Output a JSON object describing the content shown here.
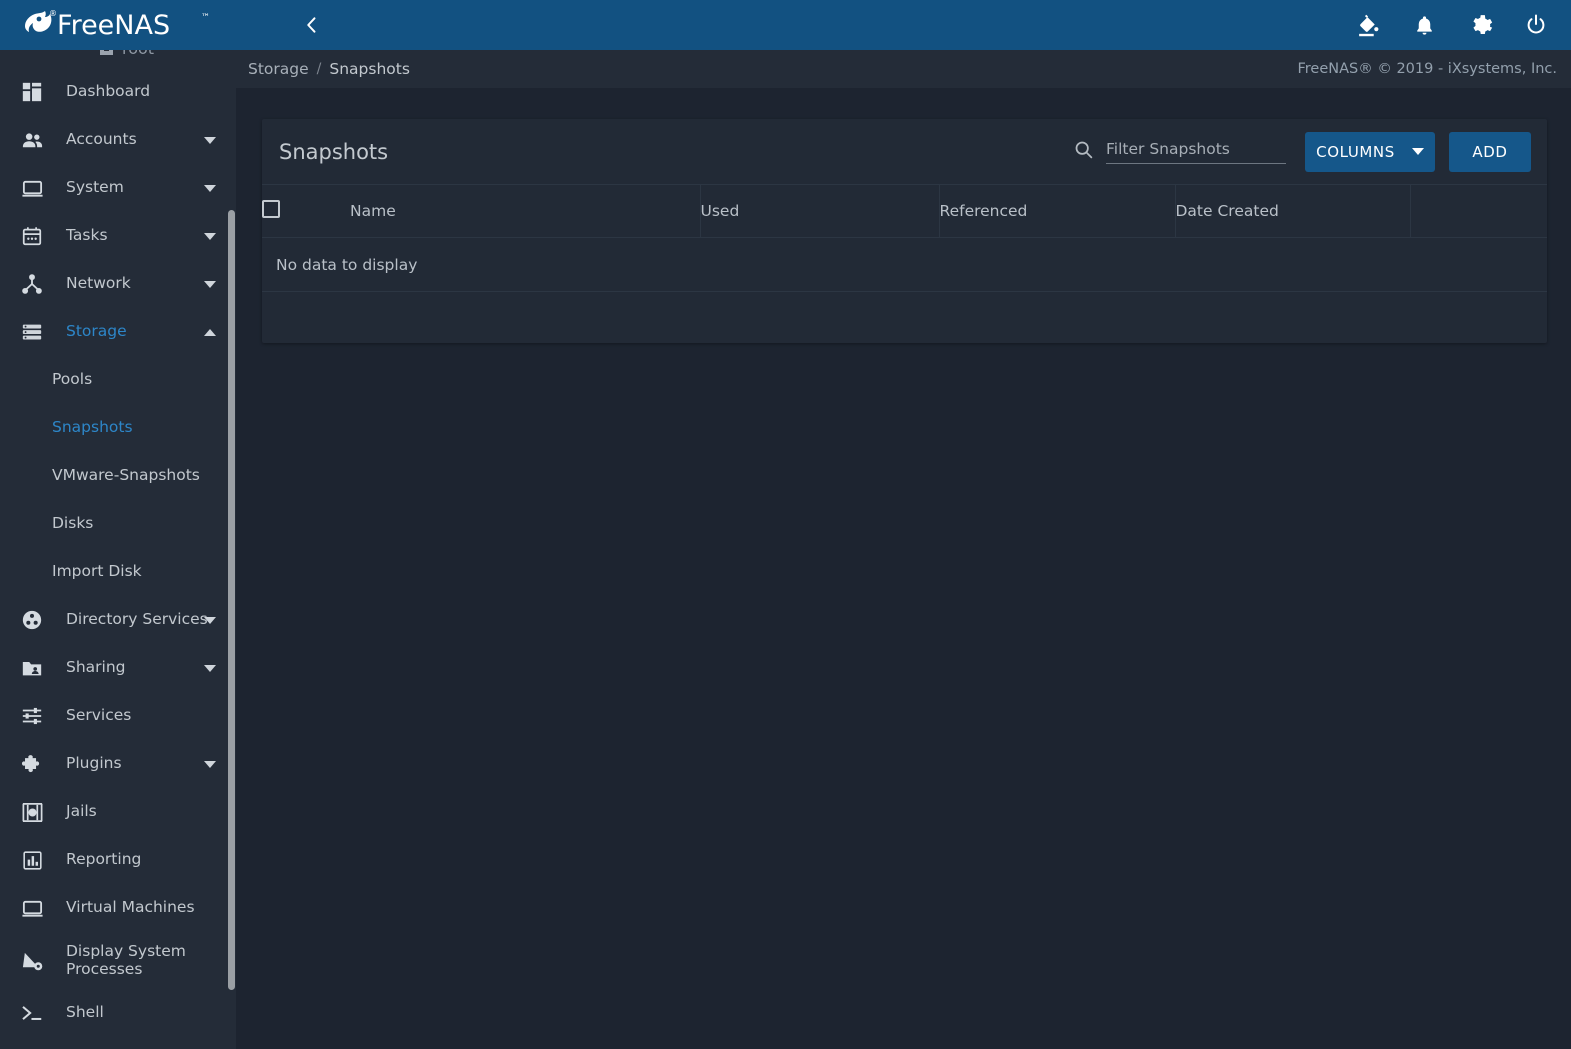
{
  "brand": {
    "name": "FreeNAS",
    "trademark": "™"
  },
  "sidebar": {
    "user": {
      "label": "root",
      "icon": "user-square-icon"
    },
    "items": [
      {
        "label": "Dashboard",
        "icon": "dashboard-icon",
        "expandable": false,
        "active": false
      },
      {
        "label": "Accounts",
        "icon": "accounts-icon",
        "expandable": true,
        "active": false
      },
      {
        "label": "System",
        "icon": "system-icon",
        "expandable": true,
        "active": false
      },
      {
        "label": "Tasks",
        "icon": "tasks-calendar-icon",
        "expandable": true,
        "active": false
      },
      {
        "label": "Network",
        "icon": "network-icon",
        "expandable": true,
        "active": false
      },
      {
        "label": "Storage",
        "icon": "storage-icon",
        "expandable": true,
        "active": true,
        "expanded": true
      },
      {
        "label": "Directory Services",
        "icon": "directory-services-icon",
        "expandable": true,
        "active": false
      },
      {
        "label": "Sharing",
        "icon": "sharing-folder-icon",
        "expandable": true,
        "active": false
      },
      {
        "label": "Services",
        "icon": "services-sliders-icon",
        "expandable": false,
        "active": false
      },
      {
        "label": "Plugins",
        "icon": "plugins-puzzle-icon",
        "expandable": true,
        "active": false
      },
      {
        "label": "Jails",
        "icon": "jails-icon",
        "expandable": false,
        "active": false
      },
      {
        "label": "Reporting",
        "icon": "reporting-chart-icon",
        "expandable": false,
        "active": false
      },
      {
        "label": "Virtual Machines",
        "icon": "virtual-machines-icon",
        "expandable": false,
        "active": false
      },
      {
        "label": "Display System Processes",
        "icon": "display-system-processes-icon",
        "expandable": false,
        "active": false
      },
      {
        "label": "Shell",
        "icon": "shell-prompt-icon",
        "expandable": false,
        "active": false
      }
    ],
    "storage_submenu": [
      {
        "label": "Pools",
        "active": false
      },
      {
        "label": "Snapshots",
        "active": true
      },
      {
        "label": "VMware-Snapshots",
        "active": false
      },
      {
        "label": "Disks",
        "active": false
      },
      {
        "label": "Import Disk",
        "active": false
      }
    ]
  },
  "topbar": {
    "menu_icon": "hamburger-menu-icon",
    "back_icon": "chevron-left-icon",
    "icons": [
      {
        "name": "theme-paint-icon"
      },
      {
        "name": "notifications-bell-icon"
      },
      {
        "name": "settings-gear-icon"
      },
      {
        "name": "power-icon"
      }
    ]
  },
  "breadcrumb": {
    "parent": "Storage",
    "separator": "/",
    "current": "Snapshots",
    "copyright": "FreeNAS® © 2019 - iXsystems, Inc."
  },
  "card": {
    "title": "Snapshots",
    "search": {
      "placeholder": "Filter Snapshots",
      "value": "",
      "icon": "search-icon"
    },
    "columns_button": "COLUMNS",
    "add_button": "ADD",
    "table": {
      "headers": [
        "",
        "Name",
        "Used",
        "Referenced",
        "Date Created",
        ""
      ],
      "rows": [],
      "empty_message": "No data to display"
    }
  },
  "colors": {
    "header_blue": "#125181",
    "button_blue": "#15578a",
    "accent_blue": "#2d86c8",
    "page_bg": "#1d2430",
    "card_bg": "#222a36",
    "sidebar_bg": "#242c38"
  }
}
